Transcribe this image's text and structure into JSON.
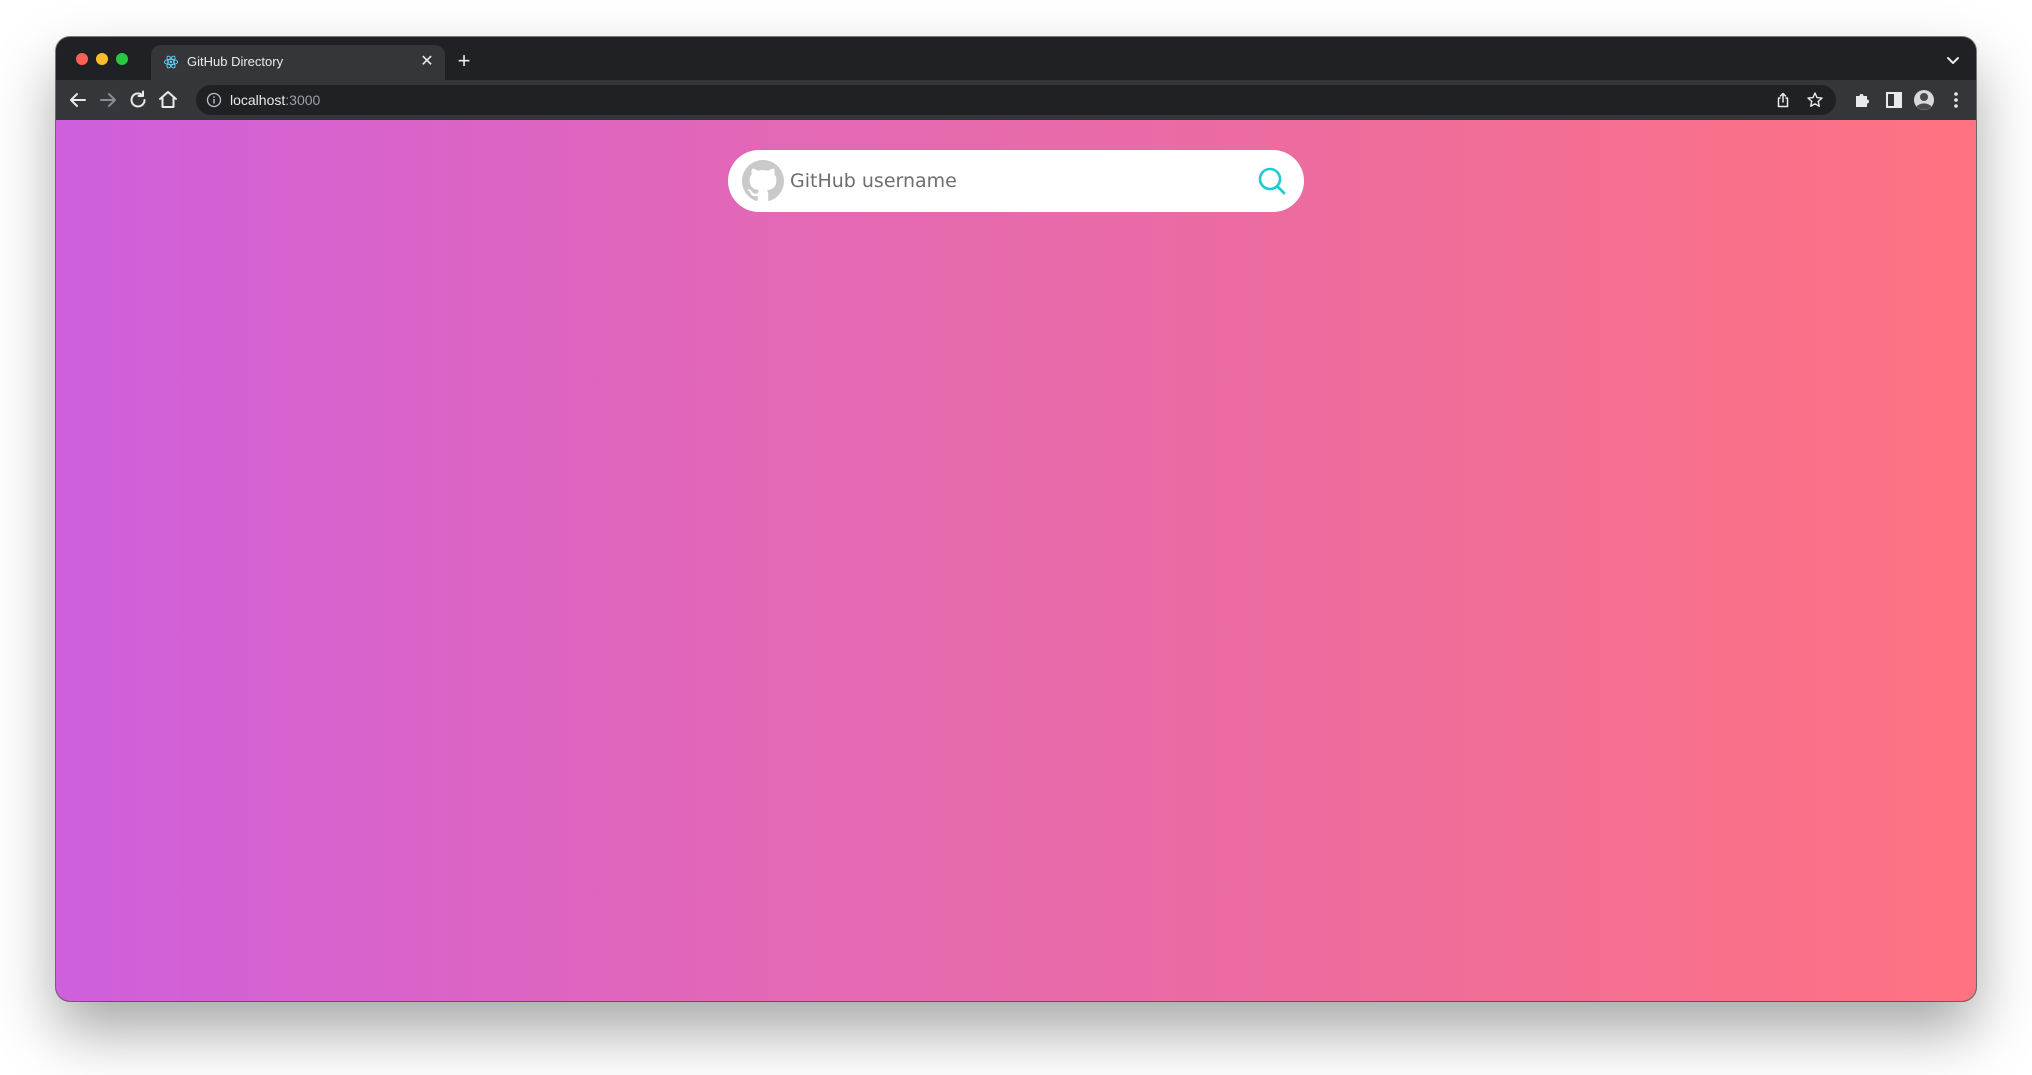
{
  "browser": {
    "tab": {
      "title": "GitHub Directory",
      "favicon": "react-icon",
      "close_icon": "close-icon"
    },
    "new_tab_icon": "plus-icon",
    "tab_menu_icon": "chevron-down-icon",
    "toolbar": {
      "back_icon": "back-arrow-icon",
      "forward_icon": "forward-arrow-icon",
      "reload_icon": "reload-icon",
      "home_icon": "home-icon",
      "omnibox": {
        "host": "localhost",
        "port": ":3000",
        "info_icon": "info-icon",
        "share_icon": "share-icon",
        "bookmark_icon": "star-icon"
      },
      "extensions_icon": "puzzle-icon",
      "side_panel_icon": "side-panel-icon",
      "profile_icon": "avatar-icon",
      "menu_icon": "kebab-menu-icon"
    }
  },
  "page": {
    "background_gradient": [
      "#cf5fdc",
      "#ff7281"
    ],
    "search": {
      "logo_icon": "github-icon",
      "placeholder": "GitHub username",
      "value": "",
      "search_icon": "search-icon",
      "search_icon_color": "#1ccbd6"
    }
  }
}
